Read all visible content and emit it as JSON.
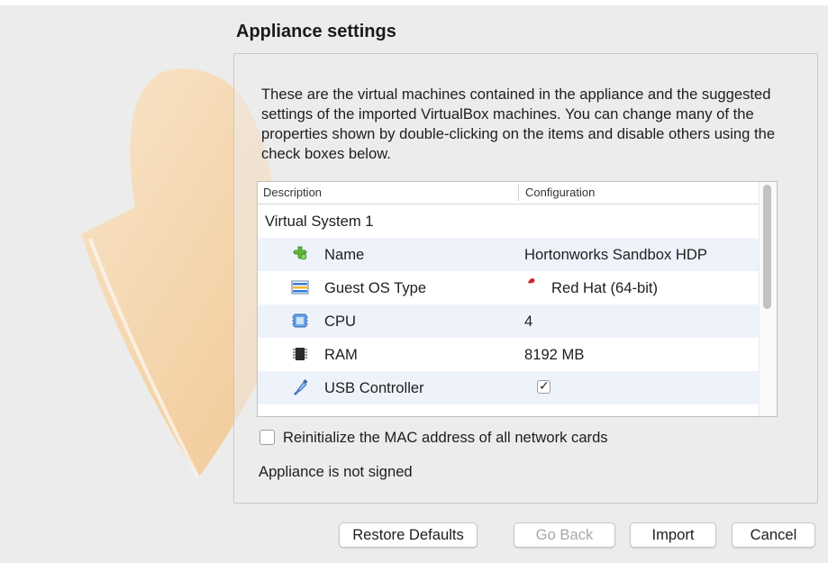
{
  "title": "Appliance settings",
  "intro": "These are the virtual machines contained in the appliance and the suggested settings of the imported VirtualBox machines. You can change many of the properties shown by double-clicking on the items and disable others using the check boxes below.",
  "table": {
    "headers": {
      "description": "Description",
      "configuration": "Configuration"
    },
    "group": "Virtual System 1",
    "rows": [
      {
        "icon": "name-puzzle-icon",
        "description": "Name",
        "configuration": "Hortonworks Sandbox HDP"
      },
      {
        "icon": "guest-os-type-icon",
        "description": "Guest OS Type",
        "configuration": "Red Hat (64-bit)",
        "os_icon": "red-hat-icon"
      },
      {
        "icon": "cpu-chip-icon",
        "description": "CPU",
        "configuration": "4"
      },
      {
        "icon": "ram-chip-icon",
        "description": "RAM",
        "configuration": "8192 MB"
      },
      {
        "icon": "usb-plug-icon",
        "description": "USB Controller",
        "configuration_checked": true
      }
    ]
  },
  "options": {
    "mac_label": "Reinitialize the MAC address of all network cards",
    "mac_checked": false
  },
  "signature_status": "Appliance is not signed",
  "buttons": {
    "restore": "Restore Defaults",
    "back": "Go Back",
    "import": "Import",
    "cancel": "Cancel"
  },
  "colors": {
    "row_highlight": "#eef3fb",
    "background": "#ececec",
    "watermark": "#f6c98e"
  }
}
